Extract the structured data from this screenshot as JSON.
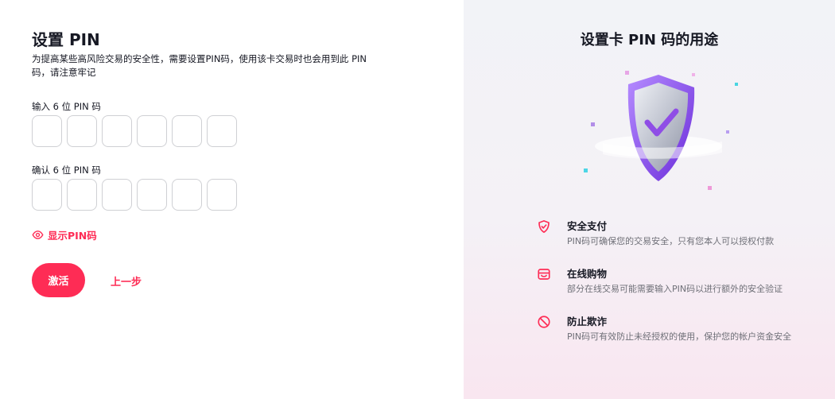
{
  "left": {
    "title": "设置 PIN",
    "description": "为提高某些高风险交易的安全性，需要设置PIN码，使用该卡交易时也会用到此 PIN 码，请注意牢记",
    "enter_label": "输入 6 位 PIN 码",
    "confirm_label": "确认 6 位 PIN 码",
    "show_pin_label": "显示PIN码",
    "activate_label": "激活",
    "back_label": "上一步"
  },
  "right": {
    "title": "设置卡 PIN 码的用途",
    "features": [
      {
        "icon": "shield-check-icon",
        "title": "安全支付",
        "desc": "PIN码可确保您的交易安全，只有您本人可以授权付款"
      },
      {
        "icon": "shopping-bag-icon",
        "title": "在线购物",
        "desc": "部分在线交易可能需要输入PIN码以进行额外的安全验证"
      },
      {
        "icon": "prohibited-icon",
        "title": "防止欺诈",
        "desc": "PIN码可有效防止未经授权的使用，保护您的帐户资金安全"
      }
    ]
  },
  "colors": {
    "accent": "#fe2c55",
    "text": "#161823",
    "muted": "#6f7078",
    "box_border": "#cfd0d4"
  }
}
